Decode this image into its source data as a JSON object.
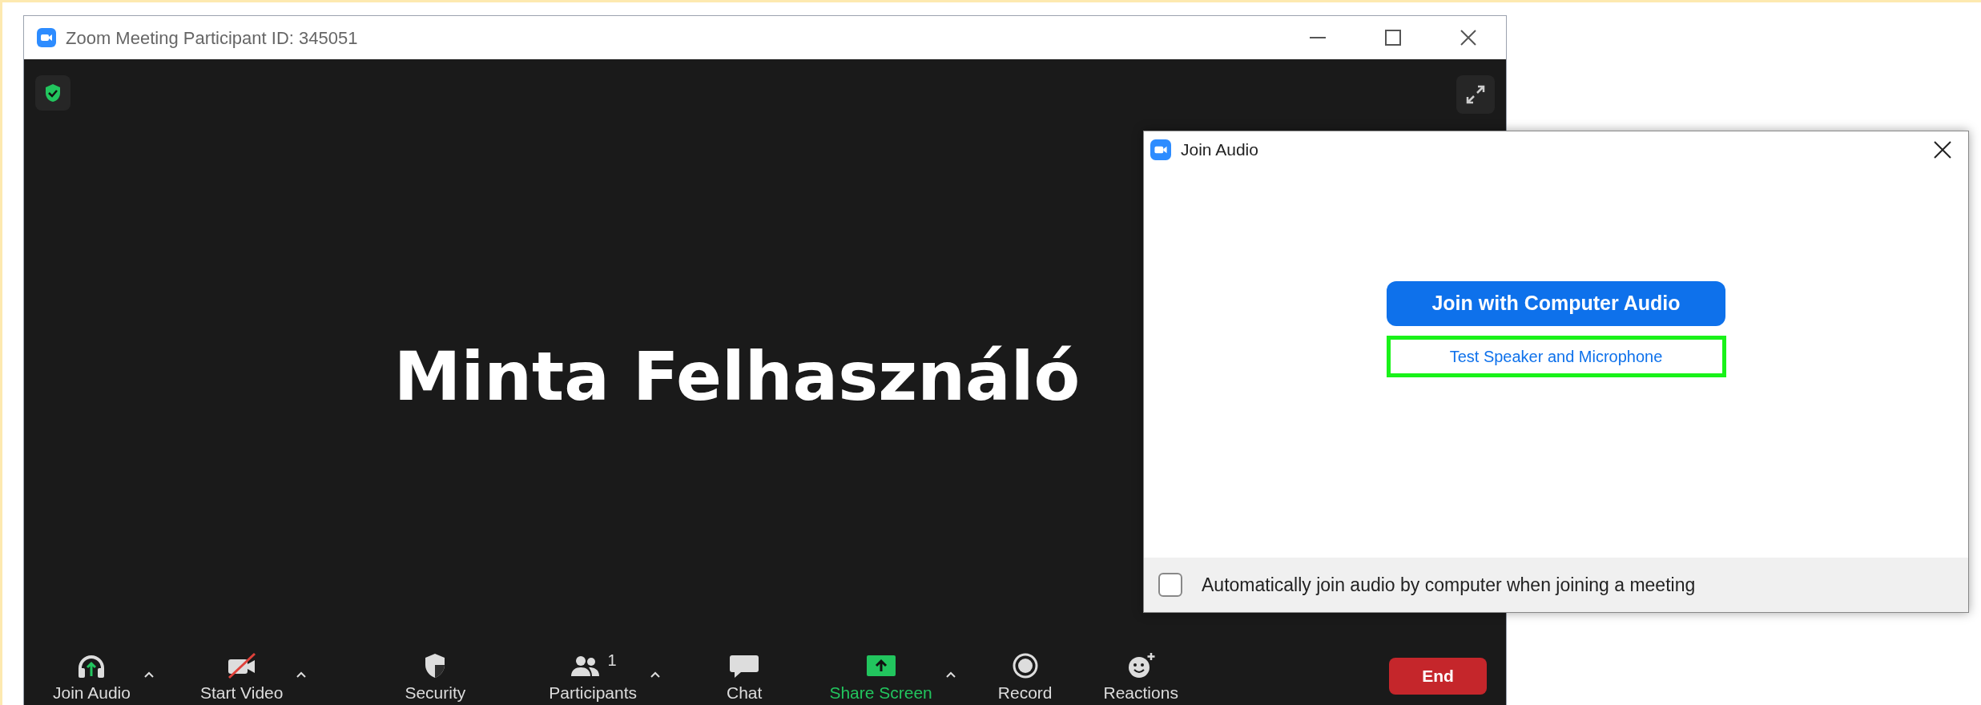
{
  "window": {
    "title": "Zoom Meeting Participant ID: 345051"
  },
  "meeting": {
    "participant_name": "Minta Felhasználó"
  },
  "toolbar": [
    {
      "kind": "audio",
      "label": "Join Audio",
      "has_menu": true
    },
    {
      "kind": "video",
      "label": "Start Video",
      "has_menu": true,
      "muted": true
    },
    {
      "kind": "security",
      "label": "Security",
      "has_menu": false
    },
    {
      "kind": "participants",
      "label": "Participants",
      "has_menu": true,
      "count": "1"
    },
    {
      "kind": "chat",
      "label": "Chat",
      "has_menu": false
    },
    {
      "kind": "share",
      "label": "Share Screen",
      "has_menu": true
    },
    {
      "kind": "record",
      "label": "Record",
      "has_menu": false
    },
    {
      "kind": "reactions",
      "label": "Reactions",
      "has_menu": false
    }
  ],
  "end_button": "End",
  "dialog": {
    "title": "Join Audio",
    "primary_button": "Join with Computer Audio",
    "link": {
      "label": "Test Speaker and Microphone",
      "highlighted": true
    },
    "auto_join": {
      "label": "Automatically join audio by computer when joining a meeting",
      "checked": false
    }
  }
}
